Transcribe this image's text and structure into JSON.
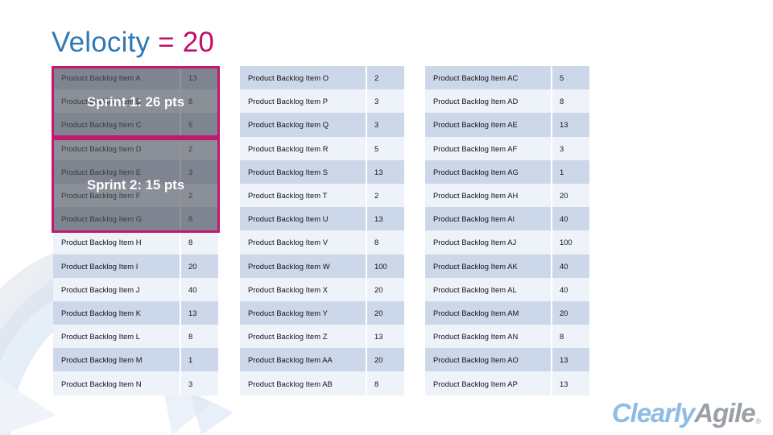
{
  "title": {
    "main": "Velocity ",
    "accent": "= 20",
    "full": "Velocity = 20"
  },
  "sprints": [
    {
      "label": "Sprint 1: 26 pts",
      "name": "Sprint 1",
      "points": 26,
      "items": [
        "A",
        "B",
        "C"
      ]
    },
    {
      "label": "Sprint 2: 15 pts",
      "name": "Sprint 2",
      "points": 15,
      "items": [
        "D",
        "E",
        "F",
        "G"
      ]
    }
  ],
  "columns": [
    {
      "id": "column-1",
      "rows": [
        {
          "name": "Product Backlog Item A",
          "points": "13"
        },
        {
          "name": "Product Backlog Item B",
          "points": "8"
        },
        {
          "name": "Product Backlog Item C",
          "points": "5"
        },
        {
          "name": "Product Backlog Item D",
          "points": "2"
        },
        {
          "name": "Product Backlog Item E",
          "points": "3"
        },
        {
          "name": "Product Backlog Item F",
          "points": "2"
        },
        {
          "name": "Product Backlog Item G",
          "points": "8"
        },
        {
          "name": "Product Backlog Item H",
          "points": "8"
        },
        {
          "name": "Product Backlog Item I",
          "points": "20"
        },
        {
          "name": "Product Backlog Item J",
          "points": "40"
        },
        {
          "name": "Product Backlog Item K",
          "points": "13"
        },
        {
          "name": "Product Backlog Item L",
          "points": "8"
        },
        {
          "name": "Product Backlog Item M",
          "points": "1"
        },
        {
          "name": "Product Backlog Item N",
          "points": "3"
        }
      ]
    },
    {
      "id": "column-2",
      "rows": [
        {
          "name": "Product Backlog Item O",
          "points": "2"
        },
        {
          "name": "Product Backlog Item P",
          "points": "3"
        },
        {
          "name": "Product Backlog Item Q",
          "points": "3"
        },
        {
          "name": "Product Backlog Item R",
          "points": "5"
        },
        {
          "name": "Product Backlog Item S",
          "points": "13"
        },
        {
          "name": "Product Backlog Item T",
          "points": "2"
        },
        {
          "name": "Product Backlog Item U",
          "points": "13"
        },
        {
          "name": "Product Backlog Item V",
          "points": "8"
        },
        {
          "name": "Product Backlog Item W",
          "points": "100"
        },
        {
          "name": "Product Backlog Item X",
          "points": "20"
        },
        {
          "name": "Product Backlog Item Y",
          "points": "20"
        },
        {
          "name": "Product Backlog Item Z",
          "points": "13"
        },
        {
          "name": "Product Backlog Item AA",
          "points": "20"
        },
        {
          "name": "Product Backlog Item AB",
          "points": "8"
        }
      ]
    },
    {
      "id": "column-3",
      "rows": [
        {
          "name": "Product Backlog Item AC",
          "points": "5"
        },
        {
          "name": "Product Backlog Item AD",
          "points": "8"
        },
        {
          "name": "Product Backlog Item AE",
          "points": "13"
        },
        {
          "name": "Product Backlog Item AF",
          "points": "3"
        },
        {
          "name": "Product Backlog Item AG",
          "points": "1"
        },
        {
          "name": "Product Backlog Item AH",
          "points": "20"
        },
        {
          "name": "Product Backlog Item AI",
          "points": "40"
        },
        {
          "name": "Product Backlog Item AJ",
          "points": "100"
        },
        {
          "name": "Product Backlog Item AK",
          "points": "40"
        },
        {
          "name": "Product Backlog Item AL",
          "points": "40"
        },
        {
          "name": "Product Backlog Item AM",
          "points": "20"
        },
        {
          "name": "Product Backlog Item AN",
          "points": "8"
        },
        {
          "name": "Product Backlog Item AO",
          "points": "13"
        },
        {
          "name": "Product Backlog Item AP",
          "points": "13"
        }
      ]
    }
  ],
  "logo": {
    "part_one": "Clearly",
    "part_two": "Agile",
    "registered": "®"
  },
  "colors": {
    "title_main": "#2E78B5",
    "title_accent": "#C10F6B",
    "sprint_border": "#C2186F",
    "row_odd": "#ccd7e9",
    "row_even": "#eef2f9",
    "logo_clearly": "#8FBCE4",
    "logo_agile": "#9AA0A6"
  }
}
